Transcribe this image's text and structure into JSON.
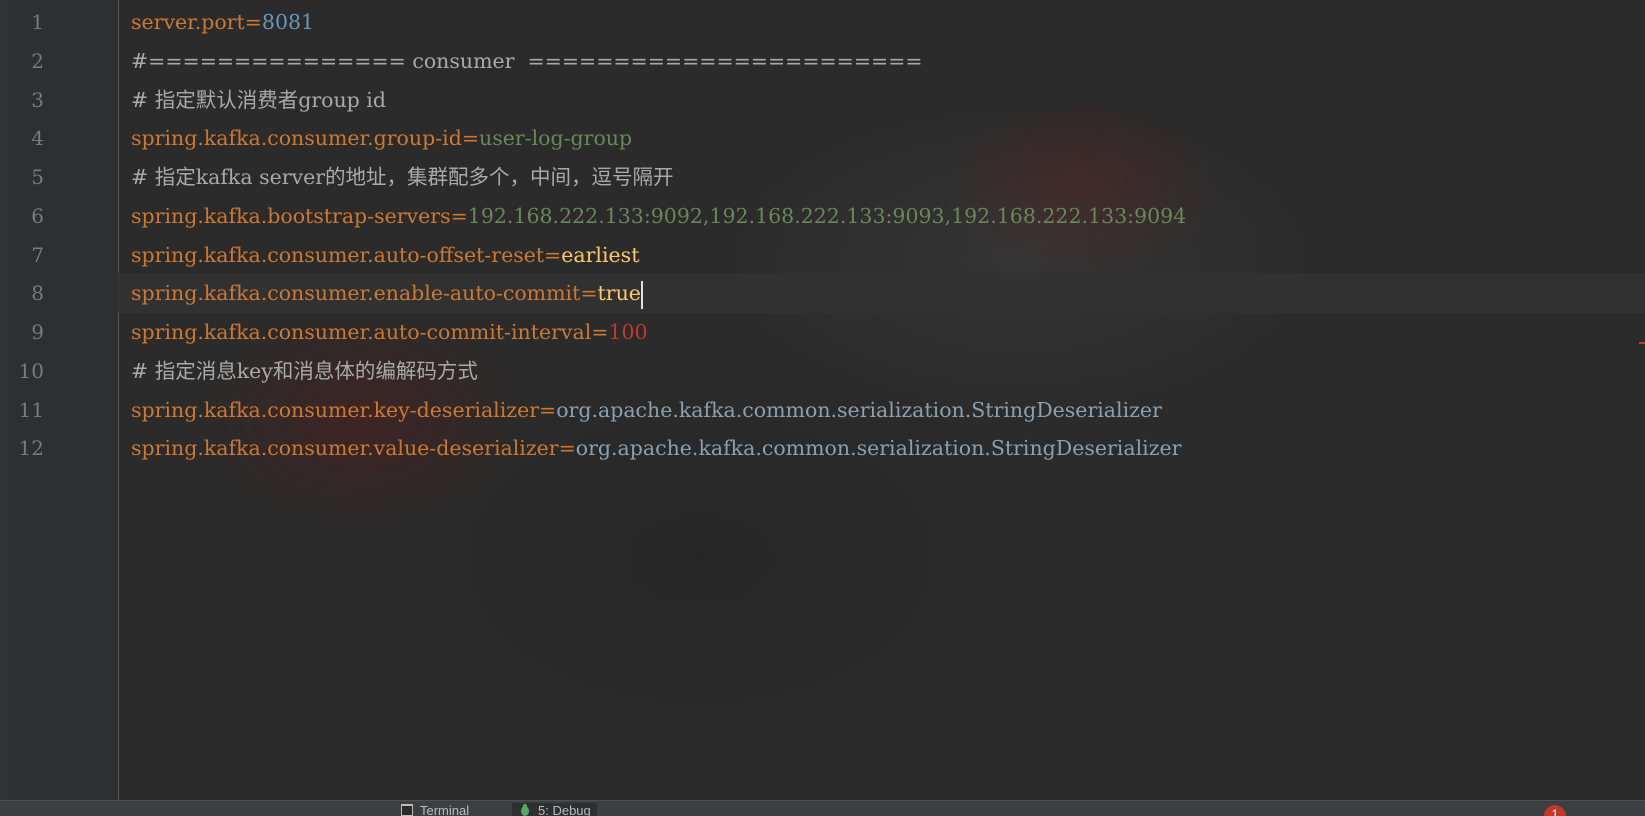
{
  "editor": {
    "line_numbers": [
      "1",
      "2",
      "3",
      "4",
      "5",
      "6",
      "7",
      "8",
      "9",
      "10",
      "11",
      "12"
    ],
    "lines": [
      {
        "key": "server.port",
        "eq": "=",
        "value": "8081"
      },
      {
        "comment": "#=============== consumer  ======================="
      },
      {
        "comment": "# 指定默认消费者group id"
      },
      {
        "key": "spring.kafka.consumer.group-id",
        "eq": "=",
        "value": "user-log-group"
      },
      {
        "comment": "# 指定kafka server的地址，集群配多个，中间，逗号隔开"
      },
      {
        "key": "spring.kafka.bootstrap-servers",
        "eq": "=",
        "value": "192.168.222.133:9092,192.168.222.133:9093,192.168.222.133:9094"
      },
      {
        "key": "spring.kafka.consumer.auto-offset-reset",
        "eq": "=",
        "value": "earliest"
      },
      {
        "key": "spring.kafka.consumer.enable-auto-commit",
        "eq": "=",
        "value": "true"
      },
      {
        "key": "spring.kafka.consumer.auto-commit-interval",
        "eq": "=",
        "value": "100"
      },
      {
        "comment": "# 指定消息key和消息体的编解码方式"
      },
      {
        "key": "spring.kafka.consumer.key-deserializer",
        "eq": "=",
        "value": "org.apache.kafka.common.serialization.StringDeserializer"
      },
      {
        "key": "spring.kafka.consumer.value-deserializer",
        "eq": "=",
        "value": "org.apache.kafka.common.serialization.StringDeserializer"
      }
    ]
  },
  "statusbar": {
    "tabs": [
      {
        "label": "Terminal",
        "icon": "terminal-icon"
      },
      {
        "label": "5: Debug",
        "icon": "bug-icon"
      }
    ],
    "badge_count": "1"
  },
  "colors": {
    "key": "#cc7832",
    "string_value": "#6a8759",
    "number_value": "#6897bb",
    "keyword_value": "#ffc66d",
    "comment": "#a9a9a9",
    "error_value": "#c0392b"
  }
}
